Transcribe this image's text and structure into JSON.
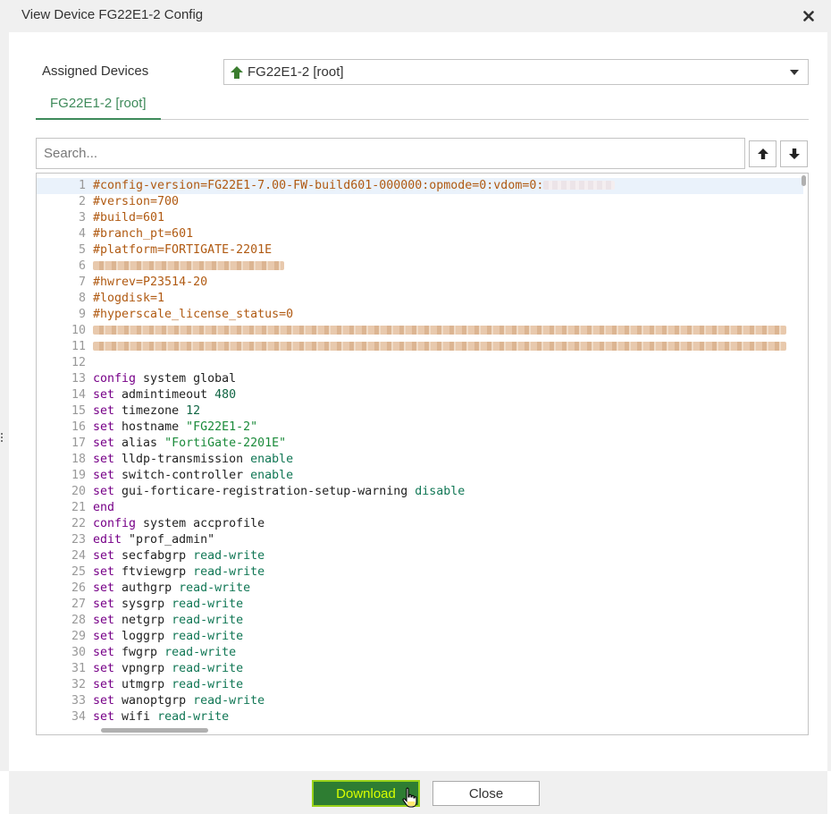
{
  "dialog": {
    "title": "View Device FG22E1-2 Config",
    "close_icon": "close-icon"
  },
  "assigned": {
    "label": "Assigned Devices",
    "value": "FG22E1-2 [root]",
    "icon": "arrow-up-icon"
  },
  "tabs": [
    {
      "label": "FG22E1-2 [root]"
    }
  ],
  "search": {
    "placeholder": "Search..."
  },
  "editor": {
    "lines": [
      {
        "n": "1",
        "tokens": [
          {
            "t": "#config-version=FG22E1-7.00-FW-build601-000000:opmode=0:vdom=0:",
            "c": "t-comment"
          }
        ],
        "redact": "light"
      },
      {
        "n": "2",
        "tokens": [
          {
            "t": "#version=700",
            "c": "t-comment"
          }
        ]
      },
      {
        "n": "3",
        "tokens": [
          {
            "t": "#build=601",
            "c": "t-comment"
          }
        ]
      },
      {
        "n": "4",
        "tokens": [
          {
            "t": "#branch_pt=601",
            "c": "t-comment"
          }
        ]
      },
      {
        "n": "5",
        "tokens": [
          {
            "t": "#platform=FORTIGATE-2201E",
            "c": "t-comment"
          }
        ]
      },
      {
        "n": "6",
        "tokens": [],
        "redact": "short"
      },
      {
        "n": "7",
        "tokens": [
          {
            "t": "#hwrev=P23514-20",
            "c": "t-comment"
          }
        ]
      },
      {
        "n": "8",
        "tokens": [
          {
            "t": "#logdisk=1",
            "c": "t-comment"
          }
        ]
      },
      {
        "n": "9",
        "tokens": [
          {
            "t": "#hyperscale_license_status=0",
            "c": "t-comment"
          }
        ]
      },
      {
        "n": "10",
        "tokens": [],
        "redact": "full"
      },
      {
        "n": "11",
        "tokens": [],
        "redact": "full"
      },
      {
        "n": "12",
        "tokens": []
      },
      {
        "n": "13",
        "tokens": [
          {
            "t": "config",
            "c": "t-kw"
          },
          {
            "t": " system global",
            "c": "t-plain"
          }
        ]
      },
      {
        "n": "14",
        "tokens": [
          {
            "t": "set",
            "c": "t-kw"
          },
          {
            "t": " admintimeout ",
            "c": "t-plain"
          },
          {
            "t": "480",
            "c": "t-num"
          }
        ]
      },
      {
        "n": "15",
        "tokens": [
          {
            "t": "set",
            "c": "t-kw"
          },
          {
            "t": " timezone ",
            "c": "t-plain"
          },
          {
            "t": "12",
            "c": "t-num"
          }
        ]
      },
      {
        "n": "16",
        "tokens": [
          {
            "t": "set",
            "c": "t-kw"
          },
          {
            "t": " hostname ",
            "c": "t-plain"
          },
          {
            "t": "\"FG22E1-2\"",
            "c": "t-str"
          }
        ]
      },
      {
        "n": "17",
        "tokens": [
          {
            "t": "set",
            "c": "t-kw"
          },
          {
            "t": " alias ",
            "c": "t-plain"
          },
          {
            "t": "\"FortiGate-2201E\"",
            "c": "t-str"
          }
        ]
      },
      {
        "n": "18",
        "tokens": [
          {
            "t": "set",
            "c": "t-kw"
          },
          {
            "t": " lldp-transmission ",
            "c": "t-plain"
          },
          {
            "t": "enable",
            "c": "t-enum"
          }
        ]
      },
      {
        "n": "19",
        "tokens": [
          {
            "t": "set",
            "c": "t-kw"
          },
          {
            "t": " switch-controller ",
            "c": "t-plain"
          },
          {
            "t": "enable",
            "c": "t-enum"
          }
        ]
      },
      {
        "n": "20",
        "tokens": [
          {
            "t": "set",
            "c": "t-kw"
          },
          {
            "t": " gui-forticare-registration-setup-warning ",
            "c": "t-plain"
          },
          {
            "t": "disable",
            "c": "t-enum"
          }
        ]
      },
      {
        "n": "21",
        "tokens": [
          {
            "t": "end",
            "c": "t-kw"
          }
        ]
      },
      {
        "n": "22",
        "tokens": [
          {
            "t": "config",
            "c": "t-kw"
          },
          {
            "t": " system accprofile",
            "c": "t-plain"
          }
        ]
      },
      {
        "n": "23",
        "tokens": [
          {
            "t": "edit",
            "c": "t-kw"
          },
          {
            "t": " \"prof_admin\"",
            "c": "t-plain"
          }
        ]
      },
      {
        "n": "24",
        "tokens": [
          {
            "t": "set",
            "c": "t-kw"
          },
          {
            "t": " secfabgrp ",
            "c": "t-plain"
          },
          {
            "t": "read-write",
            "c": "t-enum"
          }
        ]
      },
      {
        "n": "25",
        "tokens": [
          {
            "t": "set",
            "c": "t-kw"
          },
          {
            "t": " ftviewgrp ",
            "c": "t-plain"
          },
          {
            "t": "read-write",
            "c": "t-enum"
          }
        ]
      },
      {
        "n": "26",
        "tokens": [
          {
            "t": "set",
            "c": "t-kw"
          },
          {
            "t": " authgrp ",
            "c": "t-plain"
          },
          {
            "t": "read-write",
            "c": "t-enum"
          }
        ]
      },
      {
        "n": "27",
        "tokens": [
          {
            "t": "set",
            "c": "t-kw"
          },
          {
            "t": " sysgrp ",
            "c": "t-plain"
          },
          {
            "t": "read-write",
            "c": "t-enum"
          }
        ]
      },
      {
        "n": "28",
        "tokens": [
          {
            "t": "set",
            "c": "t-kw"
          },
          {
            "t": " netgrp ",
            "c": "t-plain"
          },
          {
            "t": "read-write",
            "c": "t-enum"
          }
        ]
      },
      {
        "n": "29",
        "tokens": [
          {
            "t": "set",
            "c": "t-kw"
          },
          {
            "t": " loggrp ",
            "c": "t-plain"
          },
          {
            "t": "read-write",
            "c": "t-enum"
          }
        ]
      },
      {
        "n": "30",
        "tokens": [
          {
            "t": "set",
            "c": "t-kw"
          },
          {
            "t": " fwgrp ",
            "c": "t-plain"
          },
          {
            "t": "read-write",
            "c": "t-enum"
          }
        ]
      },
      {
        "n": "31",
        "tokens": [
          {
            "t": "set",
            "c": "t-kw"
          },
          {
            "t": " vpngrp ",
            "c": "t-plain"
          },
          {
            "t": "read-write",
            "c": "t-enum"
          }
        ]
      },
      {
        "n": "32",
        "tokens": [
          {
            "t": "set",
            "c": "t-kw"
          },
          {
            "t": " utmgrp ",
            "c": "t-plain"
          },
          {
            "t": "read-write",
            "c": "t-enum"
          }
        ]
      },
      {
        "n": "33",
        "tokens": [
          {
            "t": "set",
            "c": "t-kw"
          },
          {
            "t": " wanoptgrp ",
            "c": "t-plain"
          },
          {
            "t": "read-write",
            "c": "t-enum"
          }
        ]
      },
      {
        "n": "34",
        "tokens": [
          {
            "t": "set",
            "c": "t-kw"
          },
          {
            "t": " wifi ",
            "c": "t-plain"
          },
          {
            "t": "read-write",
            "c": "t-enum"
          }
        ]
      }
    ]
  },
  "footer": {
    "download_label": "Download",
    "close_label": "Close"
  },
  "colors": {
    "accent": "#3e8a5a",
    "download_bg": "#2e7d32",
    "download_text": "#d9ff00",
    "comment": "#b05a12",
    "keyword": "#770088"
  }
}
